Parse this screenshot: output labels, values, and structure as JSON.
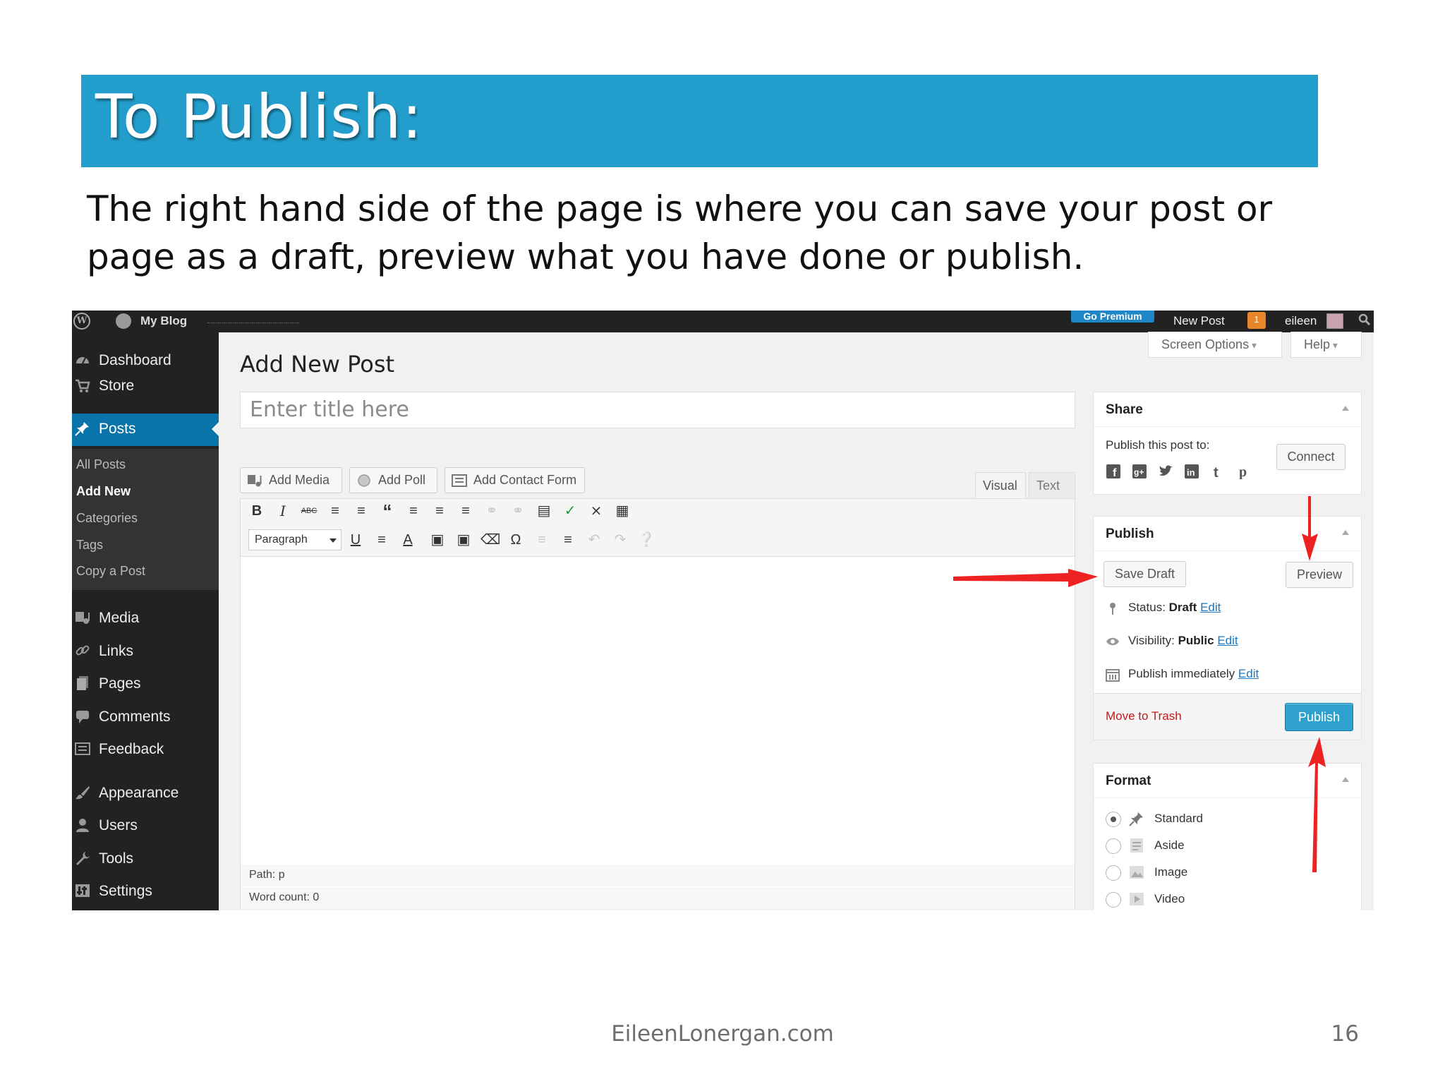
{
  "slide": {
    "title": "To Publish:",
    "body": "The right hand side of the page is where you can save your post or page as a draft, preview what you have done or publish.",
    "footer": "EileenLonergan.com",
    "page_number": "16"
  },
  "adminbar": {
    "site_name": "My Blog",
    "go_premium": "Go Premium",
    "new_post": "New Post",
    "notification_count": "1",
    "user": "eileen"
  },
  "sidebar": {
    "items": [
      {
        "label": "Dashboard",
        "icon": "dashboard-icon"
      },
      {
        "label": "Store",
        "icon": "cart-icon"
      },
      {
        "label": "Posts",
        "icon": "pin-icon"
      },
      {
        "label": "Media",
        "icon": "media-icon"
      },
      {
        "label": "Links",
        "icon": "link-icon"
      },
      {
        "label": "Pages",
        "icon": "pages-icon"
      },
      {
        "label": "Comments",
        "icon": "comment-icon"
      },
      {
        "label": "Feedback",
        "icon": "feedback-icon"
      },
      {
        "label": "Appearance",
        "icon": "brush-icon"
      },
      {
        "label": "Users",
        "icon": "user-icon"
      },
      {
        "label": "Tools",
        "icon": "wrench-icon"
      },
      {
        "label": "Settings",
        "icon": "settings-icon"
      }
    ],
    "posts_submenu": [
      "All Posts",
      "Add New",
      "Categories",
      "Tags",
      "Copy a Post"
    ]
  },
  "header": {
    "page_title": "Add New Post",
    "screen_options": "Screen Options",
    "help": "Help"
  },
  "editor": {
    "title_placeholder": "Enter title here",
    "buttons": {
      "add_media": "Add Media",
      "add_poll": "Add Poll",
      "add_contact_form": "Add Contact Form"
    },
    "tabs": {
      "visual": "Visual",
      "text": "Text"
    },
    "format_select": "Paragraph",
    "path": "Path: p",
    "word_count": "Word count: 0"
  },
  "share": {
    "title": "Share",
    "label": "Publish this post to:",
    "connect": "Connect",
    "services": [
      "facebook-icon",
      "google-plus-icon",
      "twitter-icon",
      "linkedin-icon",
      "tumblr-icon",
      "pinterest-icon"
    ]
  },
  "publish": {
    "title": "Publish",
    "save_draft": "Save Draft",
    "preview": "Preview",
    "status_label": "Status:",
    "status_value": "Draft",
    "visibility_label": "Visibility:",
    "visibility_value": "Public",
    "schedule_value": "Publish immediately",
    "edit": "Edit",
    "move_to_trash": "Move to Trash",
    "publish_button": "Publish"
  },
  "format": {
    "title": "Format",
    "options": [
      "Standard",
      "Aside",
      "Image",
      "Video"
    ],
    "selected": "Standard"
  },
  "colors": {
    "title_bar": "#239ecc",
    "admin_dark": "#222222",
    "active_menu": "#0a74aa",
    "primary_button": "#2ea2cc",
    "trash_red": "#c41a1a",
    "annotation_arrow": "#ee2222"
  }
}
